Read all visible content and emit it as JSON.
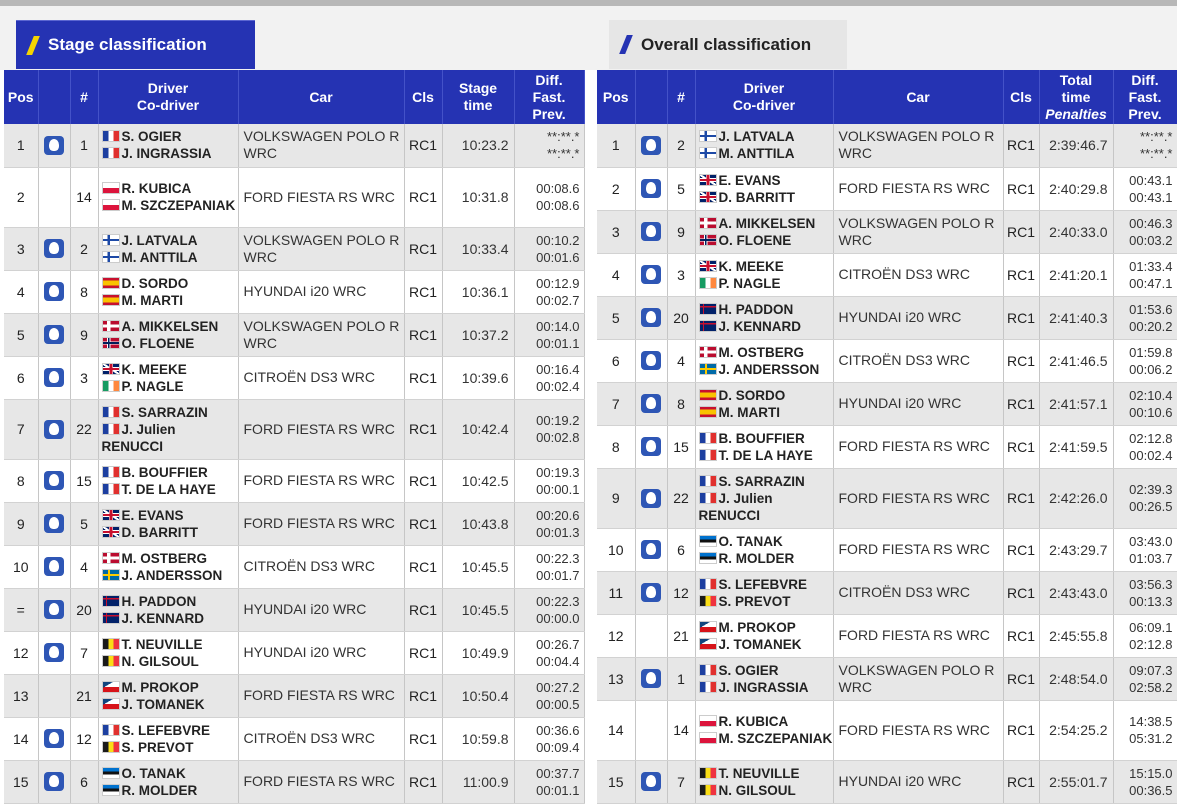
{
  "tabs": {
    "stage_label": "Stage classification",
    "overall_label": "Overall classification"
  },
  "stage": {
    "headers": {
      "pos": "Pos",
      "num": "#",
      "driver": "Driver",
      "codriver": "Co-driver",
      "car": "Car",
      "cls": "Cls",
      "time1": "Stage",
      "time2": "time",
      "diff1": "Diff.",
      "diff2": "Fast.",
      "diff3": "Prev."
    },
    "rows": [
      {
        "pos": "1",
        "num": "1",
        "michelin": true,
        "driver": "S. OGIER",
        "driver_flag": "FR",
        "codriver": "J. INGRASSIA",
        "codriver_flag": "FR",
        "car": "VOLKSWAGEN POLO R WRC",
        "cls": "RC1",
        "time": "10:23.2",
        "diff_fast": "**:**.*",
        "diff_prev": "**:**.*"
      },
      {
        "pos": "2",
        "num": "14",
        "michelin": false,
        "driver": "R. KUBICA",
        "driver_flag": "PL",
        "codriver": "M. SZCZEPANIAK",
        "codriver_flag": "PL",
        "car": "FORD FIESTA RS WRC",
        "cls": "RC1",
        "time": "10:31.8",
        "diff_fast": "00:08.6",
        "diff_prev": "00:08.6"
      },
      {
        "pos": "3",
        "num": "2",
        "michelin": true,
        "driver": "J. LATVALA",
        "driver_flag": "FI",
        "codriver": "M. ANTTILA",
        "codriver_flag": "FI",
        "car": "VOLKSWAGEN POLO R WRC",
        "cls": "RC1",
        "time": "10:33.4",
        "diff_fast": "00:10.2",
        "diff_prev": "00:01.6"
      },
      {
        "pos": "4",
        "num": "8",
        "michelin": true,
        "driver": "D. SORDO",
        "driver_flag": "ES",
        "codriver": "M. MARTI",
        "codriver_flag": "ES",
        "car": "HYUNDAI i20 WRC",
        "cls": "RC1",
        "time": "10:36.1",
        "diff_fast": "00:12.9",
        "diff_prev": "00:02.7"
      },
      {
        "pos": "5",
        "num": "9",
        "michelin": true,
        "driver": "A. MIKKELSEN",
        "driver_flag": "NO",
        "codriver": "O. FLOENE",
        "codriver_flag": "NO2",
        "car": "VOLKSWAGEN POLO R WRC",
        "cls": "RC1",
        "time": "10:37.2",
        "diff_fast": "00:14.0",
        "diff_prev": "00:01.1"
      },
      {
        "pos": "6",
        "num": "3",
        "michelin": true,
        "driver": "K. MEEKE",
        "driver_flag": "GB",
        "codriver": "P. NAGLE",
        "codriver_flag": "IE",
        "car": "CITROËN DS3 WRC",
        "cls": "RC1",
        "time": "10:39.6",
        "diff_fast": "00:16.4",
        "diff_prev": "00:02.4"
      },
      {
        "pos": "7",
        "num": "22",
        "michelin": true,
        "driver": "S. SARRAZIN",
        "driver_flag": "FR",
        "codriver": "J. Julien RENUCCI",
        "codriver_flag": "FR",
        "car": "FORD FIESTA RS WRC",
        "cls": "RC1",
        "time": "10:42.4",
        "diff_fast": "00:19.2",
        "diff_prev": "00:02.8"
      },
      {
        "pos": "8",
        "num": "15",
        "michelin": true,
        "driver": "B. BOUFFIER",
        "driver_flag": "FR",
        "codriver": "T. DE LA HAYE",
        "codriver_flag": "FR",
        "car": "FORD FIESTA RS WRC",
        "cls": "RC1",
        "time": "10:42.5",
        "diff_fast": "00:19.3",
        "diff_prev": "00:00.1"
      },
      {
        "pos": "9",
        "num": "5",
        "michelin": true,
        "driver": "E. EVANS",
        "driver_flag": "GB",
        "codriver": "D. BARRITT",
        "codriver_flag": "GB",
        "car": "FORD FIESTA RS WRC",
        "cls": "RC1",
        "time": "10:43.8",
        "diff_fast": "00:20.6",
        "diff_prev": "00:01.3"
      },
      {
        "pos": "10",
        "num": "4",
        "michelin": true,
        "driver": "M. OSTBERG",
        "driver_flag": "NO",
        "codriver": "J. ANDERSSON",
        "codriver_flag": "SE",
        "car": "CITROËN DS3 WRC",
        "cls": "RC1",
        "time": "10:45.5",
        "diff_fast": "00:22.3",
        "diff_prev": "00:01.7"
      },
      {
        "pos": "=",
        "num": "20",
        "michelin": true,
        "driver": "H. PADDON",
        "driver_flag": "NZ",
        "codriver": "J. KENNARD",
        "codriver_flag": "NZ",
        "car": "HYUNDAI i20 WRC",
        "cls": "RC1",
        "time": "10:45.5",
        "diff_fast": "00:22.3",
        "diff_prev": "00:00.0"
      },
      {
        "pos": "12",
        "num": "7",
        "michelin": true,
        "driver": "T. NEUVILLE",
        "driver_flag": "BE",
        "codriver": "N. GILSOUL",
        "codriver_flag": "BE",
        "car": "HYUNDAI i20 WRC",
        "cls": "RC1",
        "time": "10:49.9",
        "diff_fast": "00:26.7",
        "diff_prev": "00:04.4"
      },
      {
        "pos": "13",
        "num": "21",
        "michelin": false,
        "driver": "M. PROKOP",
        "driver_flag": "CZ",
        "codriver": "J. TOMANEK",
        "codriver_flag": "CZ",
        "car": "FORD FIESTA RS WRC",
        "cls": "RC1",
        "time": "10:50.4",
        "diff_fast": "00:27.2",
        "diff_prev": "00:00.5"
      },
      {
        "pos": "14",
        "num": "12",
        "michelin": true,
        "driver": "S. LEFEBVRE",
        "driver_flag": "FR",
        "codriver": "S. PREVOT",
        "codriver_flag": "BE",
        "car": "CITROËN DS3 WRC",
        "cls": "RC1",
        "time": "10:59.8",
        "diff_fast": "00:36.6",
        "diff_prev": "00:09.4"
      },
      {
        "pos": "15",
        "num": "6",
        "michelin": true,
        "driver": "O. TANAK",
        "driver_flag": "EE",
        "codriver": "R. MOLDER",
        "codriver_flag": "EE",
        "car": "FORD FIESTA RS WRC",
        "cls": "RC1",
        "time": "11:00.9",
        "diff_fast": "00:37.7",
        "diff_prev": "00:01.1"
      }
    ]
  },
  "overall": {
    "headers": {
      "pos": "Pos",
      "num": "#",
      "driver": "Driver",
      "codriver": "Co-driver",
      "car": "Car",
      "cls": "Cls",
      "time1": "Total",
      "time2": "time",
      "time3": "Penalties",
      "diff1": "Diff.",
      "diff2": "Fast.",
      "diff3": "Prev."
    },
    "rows": [
      {
        "pos": "1",
        "num": "2",
        "michelin": true,
        "driver": "J. LATVALA",
        "driver_flag": "FI",
        "codriver": "M. ANTTILA",
        "codriver_flag": "FI",
        "car": "VOLKSWAGEN POLO R WRC",
        "cls": "RC1",
        "time": "2:39:46.7",
        "diff_fast": "**:**.*",
        "diff_prev": "**:**.*"
      },
      {
        "pos": "2",
        "num": "5",
        "michelin": true,
        "driver": "E. EVANS",
        "driver_flag": "GB",
        "codriver": "D. BARRITT",
        "codriver_flag": "GB",
        "car": "FORD FIESTA RS WRC",
        "cls": "RC1",
        "time": "2:40:29.8",
        "diff_fast": "00:43.1",
        "diff_prev": "00:43.1"
      },
      {
        "pos": "3",
        "num": "9",
        "michelin": true,
        "driver": "A. MIKKELSEN",
        "driver_flag": "NO",
        "codriver": "O. FLOENE",
        "codriver_flag": "NO2",
        "car": "VOLKSWAGEN POLO R WRC",
        "cls": "RC1",
        "time": "2:40:33.0",
        "diff_fast": "00:46.3",
        "diff_prev": "00:03.2"
      },
      {
        "pos": "4",
        "num": "3",
        "michelin": true,
        "driver": "K. MEEKE",
        "driver_flag": "GB",
        "codriver": "P. NAGLE",
        "codriver_flag": "IE",
        "car": "CITROËN DS3 WRC",
        "cls": "RC1",
        "time": "2:41:20.1",
        "diff_fast": "01:33.4",
        "diff_prev": "00:47.1"
      },
      {
        "pos": "5",
        "num": "20",
        "michelin": true,
        "driver": "H. PADDON",
        "driver_flag": "NZ",
        "codriver": "J. KENNARD",
        "codriver_flag": "NZ",
        "car": "HYUNDAI i20 WRC",
        "cls": "RC1",
        "time": "2:41:40.3",
        "diff_fast": "01:53.6",
        "diff_prev": "00:20.2"
      },
      {
        "pos": "6",
        "num": "4",
        "michelin": true,
        "driver": "M. OSTBERG",
        "driver_flag": "NO",
        "codriver": "J. ANDERSSON",
        "codriver_flag": "SE",
        "car": "CITROËN DS3 WRC",
        "cls": "RC1",
        "time": "2:41:46.5",
        "diff_fast": "01:59.8",
        "diff_prev": "00:06.2"
      },
      {
        "pos": "7",
        "num": "8",
        "michelin": true,
        "driver": "D. SORDO",
        "driver_flag": "ES",
        "codriver": "M. MARTI",
        "codriver_flag": "ES",
        "car": "HYUNDAI i20 WRC",
        "cls": "RC1",
        "time": "2:41:57.1",
        "diff_fast": "02:10.4",
        "diff_prev": "00:10.6"
      },
      {
        "pos": "8",
        "num": "15",
        "michelin": true,
        "driver": "B. BOUFFIER",
        "driver_flag": "FR",
        "codriver": "T. DE LA HAYE",
        "codriver_flag": "FR",
        "car": "FORD FIESTA RS WRC",
        "cls": "RC1",
        "time": "2:41:59.5",
        "diff_fast": "02:12.8",
        "diff_prev": "00:02.4"
      },
      {
        "pos": "9",
        "num": "22",
        "michelin": true,
        "driver": "S. SARRAZIN",
        "driver_flag": "FR",
        "codriver": "J. Julien RENUCCI",
        "codriver_flag": "FR",
        "car": "FORD FIESTA RS WRC",
        "cls": "RC1",
        "time": "2:42:26.0",
        "diff_fast": "02:39.3",
        "diff_prev": "00:26.5"
      },
      {
        "pos": "10",
        "num": "6",
        "michelin": true,
        "driver": "O. TANAK",
        "driver_flag": "EE",
        "codriver": "R. MOLDER",
        "codriver_flag": "EE",
        "car": "FORD FIESTA RS WRC",
        "cls": "RC1",
        "time": "2:43:29.7",
        "diff_fast": "03:43.0",
        "diff_prev": "01:03.7"
      },
      {
        "pos": "11",
        "num": "12",
        "michelin": true,
        "driver": "S. LEFEBVRE",
        "driver_flag": "FR",
        "codriver": "S. PREVOT",
        "codriver_flag": "BE",
        "car": "CITROËN DS3 WRC",
        "cls": "RC1",
        "time": "2:43:43.0",
        "diff_fast": "03:56.3",
        "diff_prev": "00:13.3"
      },
      {
        "pos": "12",
        "num": "21",
        "michelin": false,
        "driver": "M. PROKOP",
        "driver_flag": "CZ",
        "codriver": "J. TOMANEK",
        "codriver_flag": "CZ",
        "car": "FORD FIESTA RS WRC",
        "cls": "RC1",
        "time": "2:45:55.8",
        "diff_fast": "06:09.1",
        "diff_prev": "02:12.8"
      },
      {
        "pos": "13",
        "num": "1",
        "michelin": true,
        "driver": "S. OGIER",
        "driver_flag": "FR",
        "codriver": "J. INGRASSIA",
        "codriver_flag": "FR",
        "car": "VOLKSWAGEN POLO R WRC",
        "cls": "RC1",
        "time": "2:48:54.0",
        "diff_fast": "09:07.3",
        "diff_prev": "02:58.2"
      },
      {
        "pos": "14",
        "num": "14",
        "michelin": false,
        "driver": "R. KUBICA",
        "driver_flag": "PL",
        "codriver": "M. SZCZEPANIAK",
        "codriver_flag": "PL",
        "car": "FORD FIESTA RS WRC",
        "cls": "RC1",
        "time": "2:54:25.2",
        "diff_fast": "14:38.5",
        "diff_prev": "05:31.2"
      },
      {
        "pos": "15",
        "num": "7",
        "michelin": true,
        "driver": "T. NEUVILLE",
        "driver_flag": "BE",
        "codriver": "N. GILSOUL",
        "codriver_flag": "BE",
        "car": "HYUNDAI i20 WRC",
        "cls": "RC1",
        "time": "2:55:01.7",
        "diff_fast": "15:15.0",
        "diff_prev": "00:36.5"
      }
    ]
  }
}
